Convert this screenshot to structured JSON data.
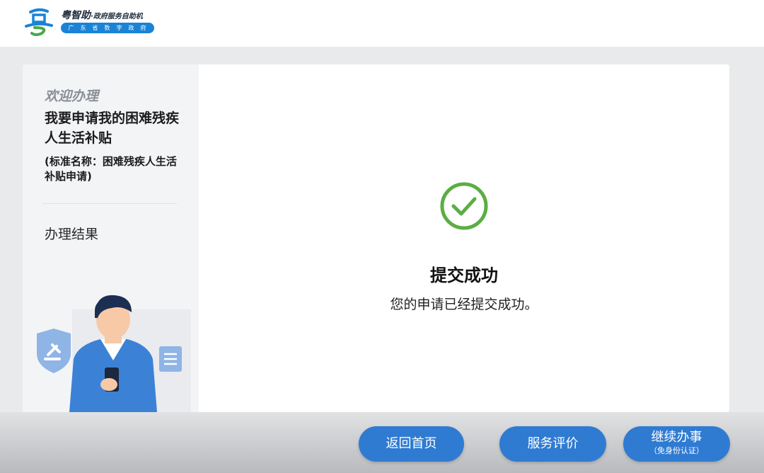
{
  "header": {
    "brand_name": "粤智助",
    "brand_sub": "·政府服务自助机",
    "brand_pill": "广东省数字政府"
  },
  "sidebar": {
    "welcome": "欢迎办理",
    "service_title": "我要申请我的困难残疾人生活补贴",
    "standard_name": "(标准名称：困难残疾人生活补贴申请)",
    "step_label": "办理结果"
  },
  "result": {
    "title": "提交成功",
    "message": "您的申请已经提交成功。",
    "icon": "check-circle-icon"
  },
  "buttons": {
    "home": "返回首页",
    "rate": "服务评价",
    "continue": "继续办事",
    "continue_sub": "（免身份认证）"
  },
  "colors": {
    "accent": "#2f7bd2",
    "success": "#5aae43",
    "brand_blue": "#1a83d6"
  }
}
